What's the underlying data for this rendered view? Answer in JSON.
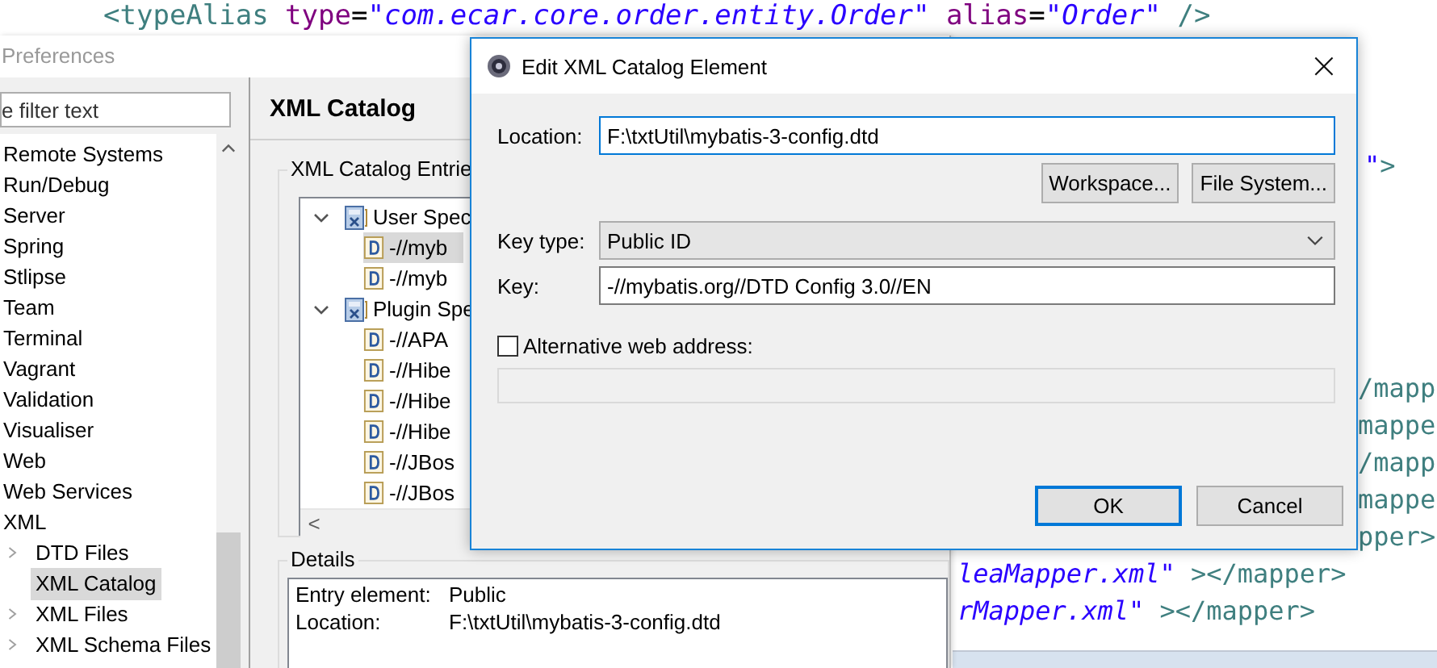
{
  "code_editor": {
    "top_line": [
      {
        "kind": "tag",
        "text": "<typeAlias"
      },
      {
        "kind": "attr",
        "text": "type",
        "gap_before": true
      },
      {
        "kind": "punct",
        "text": "="
      },
      {
        "kind": "string",
        "text": "\"com.ecar.core.order.entity.Order\""
      },
      {
        "kind": "attr",
        "text": "alias",
        "gap_before": true
      },
      {
        "kind": "punct",
        "text": "="
      },
      {
        "kind": "string",
        "text": "\"Order\""
      },
      {
        "kind": "tag",
        "text": "/>",
        "gap_before": true
      }
    ],
    "right_upper": [
      [
        {
          "kind": "string",
          "text": "\""
        },
        {
          "kind": "tag",
          "text": ">"
        }
      ]
    ],
    "right_lower": [
      [
        {
          "kind": "tag",
          "text": "/mapp"
        }
      ],
      [
        {
          "kind": "tag",
          "text": "mappe"
        }
      ],
      [
        {
          "kind": "tag",
          "text": "/mapp"
        }
      ],
      [
        {
          "kind": "tag",
          "text": "mappe"
        }
      ],
      [
        {
          "kind": "tag",
          "text": "pper>"
        }
      ]
    ],
    "bottom_lines": [
      [
        {
          "kind": "string",
          "text": "leaMapper.xml\""
        },
        {
          "kind": "tag",
          "text": "></mapper>",
          "gap_before": true
        }
      ],
      [
        {
          "kind": "string",
          "text": "rMapper.xml\""
        },
        {
          "kind": "tag",
          "text": "></mapper>",
          "gap_before": true
        }
      ]
    ]
  },
  "preferences": {
    "title": "Preferences",
    "filter": {
      "placeholder": "e filter text"
    },
    "nav_items": [
      {
        "label": "Remote Systems",
        "selected": false
      },
      {
        "label": "Run/Debug",
        "selected": false
      },
      {
        "label": "Server",
        "selected": false
      },
      {
        "label": "Spring",
        "selected": false
      },
      {
        "label": "Stlipse",
        "selected": false
      },
      {
        "label": "Team",
        "selected": false
      },
      {
        "label": "Terminal",
        "selected": false
      },
      {
        "label": "Vagrant",
        "selected": false
      },
      {
        "label": "Validation",
        "selected": false
      },
      {
        "label": "Visualiser",
        "selected": false
      },
      {
        "label": "Web",
        "selected": false
      },
      {
        "label": "Web Services",
        "selected": false
      },
      {
        "label": "XML",
        "selected": false,
        "children": [
          {
            "label": "DTD Files",
            "expandable": true,
            "selected": false
          },
          {
            "label": "XML Catalog",
            "expandable": false,
            "selected": true
          },
          {
            "label": "XML Files",
            "expandable": true,
            "selected": false
          },
          {
            "label": "XML Schema Files",
            "expandable": true,
            "selected": false
          }
        ]
      }
    ],
    "page_title": "XML Catalog",
    "entries_group": {
      "label": "XML Catalog Entrie",
      "tree": [
        {
          "label": "User Spec",
          "expanded": true,
          "children": [
            {
              "label": "-//myb",
              "selected": true
            },
            {
              "label": "-//myb",
              "selected": false
            }
          ]
        },
        {
          "label": "Plugin Spe",
          "expanded": true,
          "children": [
            {
              "label": "-//APA",
              "selected": false
            },
            {
              "label": "-//Hibe",
              "selected": false
            },
            {
              "label": "-//Hibe",
              "selected": false
            },
            {
              "label": "-//Hibe",
              "selected": false
            },
            {
              "label": "-//JBos",
              "selected": false
            },
            {
              "label": "-//JBos",
              "selected": false
            }
          ]
        }
      ],
      "scroll_left": "<"
    },
    "details": {
      "label": "Details",
      "rows": [
        {
          "label": "Entry element:",
          "value": "Public"
        },
        {
          "label": "Location:",
          "value": "F:\\txtUtil\\mybatis-3-config.dtd"
        }
      ]
    }
  },
  "dialog": {
    "title": "Edit XML Catalog Element",
    "close": "×",
    "location": {
      "label": "Location:",
      "value": "F:\\txtUtil\\mybatis-3-config.dtd"
    },
    "browse_buttons": [
      "Workspace...",
      "File System..."
    ],
    "key_type": {
      "label": "Key type:",
      "value": "Public ID"
    },
    "key": {
      "label": "Key:",
      "value": "-//mybatis.org//DTD Config 3.0//EN"
    },
    "alternative": {
      "label": "Alternative web address:",
      "checked": false
    },
    "buttons": [
      {
        "label": "OK",
        "default": true
      },
      {
        "label": "Cancel",
        "default": false
      }
    ]
  }
}
